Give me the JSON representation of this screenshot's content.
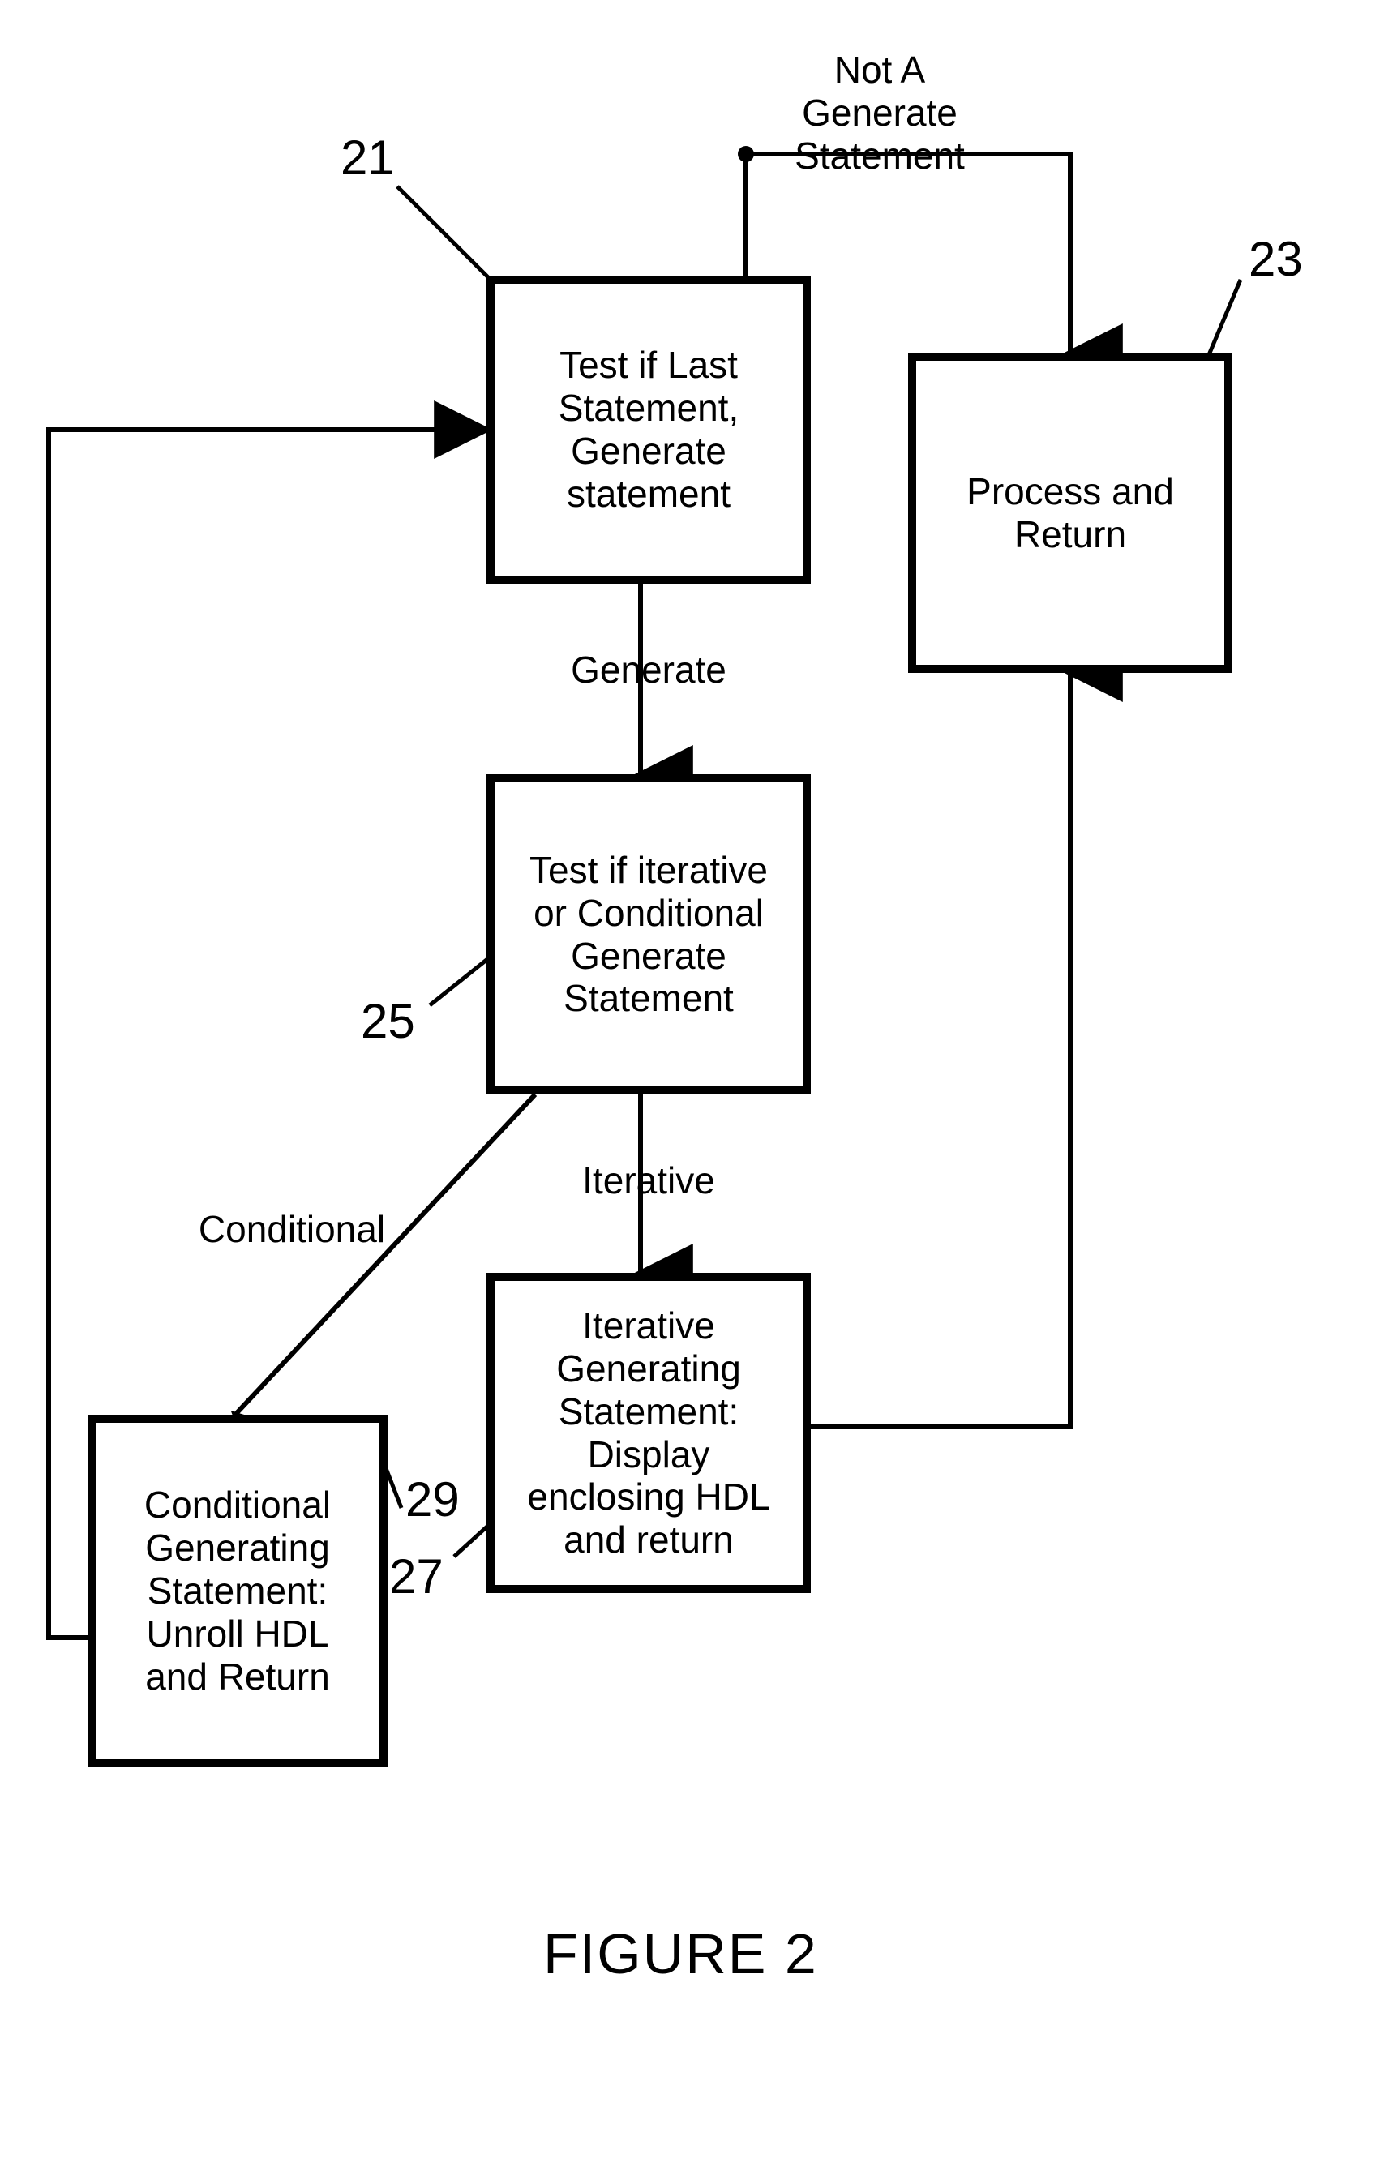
{
  "boxes": {
    "b21": "Test if Last Statement, Generate statement",
    "b23": "Process and Return",
    "b25": "Test if iterative or Conditional Generate Statement",
    "b27": "Iterative Generating Statement: Display enclosing HDL and return",
    "b29": "Conditional Generating Statement: Unroll HDL and Return"
  },
  "labels": {
    "notGenerate": "Not A Generate Statement",
    "generate": "Generate",
    "iterative": "Iterative",
    "conditional": "Conditional"
  },
  "refs": {
    "r21": "21",
    "r23": "23",
    "r25": "25",
    "r27": "27",
    "r29": "29"
  },
  "caption": "FIGURE 2"
}
